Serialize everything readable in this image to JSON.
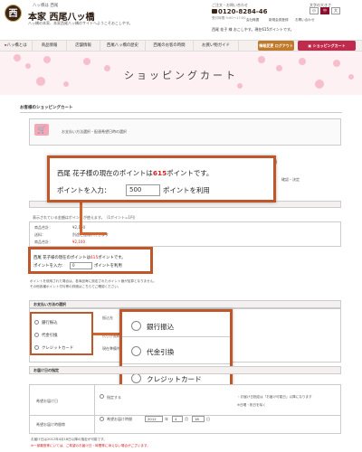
{
  "header": {
    "tagline": "八ッ橋は 西尾",
    "store_name": "本家 西尾八ッ橋",
    "welcome": "八ッ橋の本家、本家西尾八ッ橋のサイトへようこそおこしやす。",
    "logo_char": "西",
    "contact_label": "ご注文・お問い合わせ",
    "phone": "0120-8284-46",
    "hours": "受付時間 9:00〜17:00",
    "links": [
      "会社概要",
      "新規会員登録",
      "お問い合わせ"
    ],
    "user_greeting": "西尾 花子 様 おこしやす。現在615ポイントです。",
    "text_size_label": "文字の大きさ",
    "text_sizes": [
      "小",
      "中",
      "大"
    ]
  },
  "nav": {
    "items": [
      "八ッ橋とは",
      "商品情報",
      "店舗情報",
      "西尾八ッ橋の歴史",
      "西尾のお客の時間",
      "お買い物ガイド"
    ],
    "member_button": "情報変更 ログアウト",
    "cart_button": "ショッピングカート"
  },
  "banner": {
    "title": "ショッピングカート"
  },
  "page": {
    "cart_heading": "お客様のショッピングカート",
    "steps_text": "お支払い方法選択・配達希望日時の選択",
    "step_number": "3",
    "step_confirm": "確認・決定"
  },
  "points": {
    "callout_name": "西尾 花子様の現在のポイントは",
    "callout_points": "615",
    "callout_suffix": "ポイントです。",
    "input_label": "ポイントを入力：",
    "input_value": "500",
    "input_suffix": "ポイントを利用",
    "available_note": "表示されている金額はポイントが使えます。（1ポイント=1円）",
    "subtotal_label": "商品合計：",
    "subtotal_value": "¥2,100",
    "shipping_label": "送料：",
    "shipping_value": "別途ご連絡いたします",
    "total_label": "商品合計：",
    "total_value": "¥2,100",
    "small_line1": "西尾 花子様の現在のポイントは",
    "small_points": "615",
    "small_suffix": "ポイントです。",
    "small_input_label": "ポイントを入力：",
    "small_input_value": "0",
    "small_input_suffix": "ポイントを利用",
    "note1": "ポイントを使用された場合は、各商品毎に設定されたポイント値が加算となりません。",
    "note2": "その他各種ポイント付与等の詳細はこちらでご確認ください。"
  },
  "payment": {
    "heading": "お支払い方法の選択",
    "options": [
      "銀行振込",
      "代金引換",
      "クレジットカード"
    ],
    "side_labels": [
      "振込先",
      "代引手数料",
      "現在準備中"
    ]
  },
  "delivery": {
    "heading": "お届け日の指定",
    "date_label": "希望お届け日",
    "date_option": "指定する",
    "date_note1": "・お届け日指定は「お届け可能日」以降になります",
    "date_note2": "※日曜・祝日を除く",
    "year": "2012",
    "month": "4",
    "day": "18",
    "time_label": "希望お届け時間帯",
    "time_option": "希望お届け時間",
    "footer_note1": "お届け日は2012年4月18日以降の指定が可能です。",
    "footer_note2": "※一部離島等にいては、ご希望のお届け日・時間帯に添えない場合がございます。"
  }
}
